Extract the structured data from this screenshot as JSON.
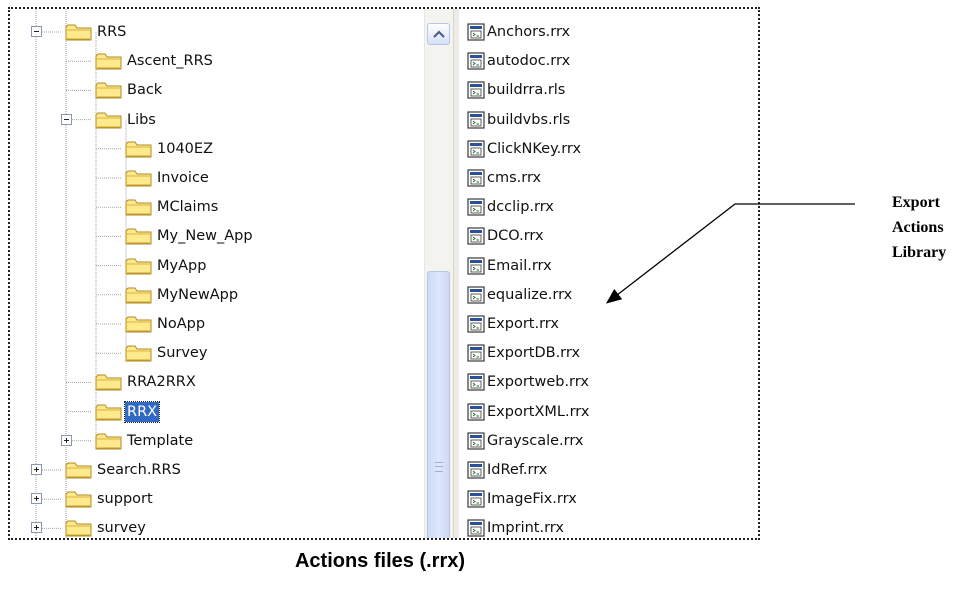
{
  "tree": {
    "nodes": [
      {
        "label": "RRS",
        "expander": "minus",
        "selected": false
      },
      {
        "label": "Ascent_RRS",
        "expander": "",
        "selected": false
      },
      {
        "label": "Back",
        "expander": "",
        "selected": false
      },
      {
        "label": "Libs",
        "expander": "minus",
        "selected": false
      },
      {
        "label": "1040EZ",
        "expander": "",
        "selected": false
      },
      {
        "label": "Invoice",
        "expander": "",
        "selected": false
      },
      {
        "label": "MClaims",
        "expander": "",
        "selected": false
      },
      {
        "label": "My_New_App",
        "expander": "",
        "selected": false
      },
      {
        "label": "MyApp",
        "expander": "",
        "selected": false
      },
      {
        "label": "MyNewApp",
        "expander": "",
        "selected": false
      },
      {
        "label": "NoApp",
        "expander": "",
        "selected": false
      },
      {
        "label": "Survey",
        "expander": "",
        "selected": false
      },
      {
        "label": "RRA2RRX",
        "expander": "",
        "selected": false
      },
      {
        "label": "RRX",
        "expander": "",
        "selected": true
      },
      {
        "label": "Template",
        "expander": "plus",
        "selected": false
      },
      {
        "label": "Search.RRS",
        "expander": "plus",
        "selected": false
      },
      {
        "label": "support",
        "expander": "plus",
        "selected": false
      },
      {
        "label": "survey",
        "expander": "plus",
        "selected": false
      }
    ]
  },
  "files": [
    "Anchors.rrx",
    "autodoc.rrx",
    "buildrra.rls",
    "buildvbs.rls",
    "ClickNKey.rrx",
    "cms.rrx",
    "dcclip.rrx",
    "DCO.rrx",
    "Email.rrx",
    "equalize.rrx",
    "Export.rrx",
    "ExportDB.rrx",
    "Exportweb.rrx",
    "ExportXML.rrx",
    "Grayscale.rrx",
    "IdRef.rrx",
    "ImageFix.rrx",
    "Imprint.rrx"
  ],
  "annotation": {
    "line1": "Export",
    "line2": "Actions",
    "line3": "Library"
  },
  "caption": "Actions files (.rrx)",
  "icons": {
    "folder": "folder-icon",
    "file": "script-file-icon",
    "scroll_up": "scroll-up-arrow-icon"
  },
  "colors": {
    "selection": "#316ac5",
    "folder_fill": "#ffe98d",
    "folder_stroke": "#b08a20"
  }
}
